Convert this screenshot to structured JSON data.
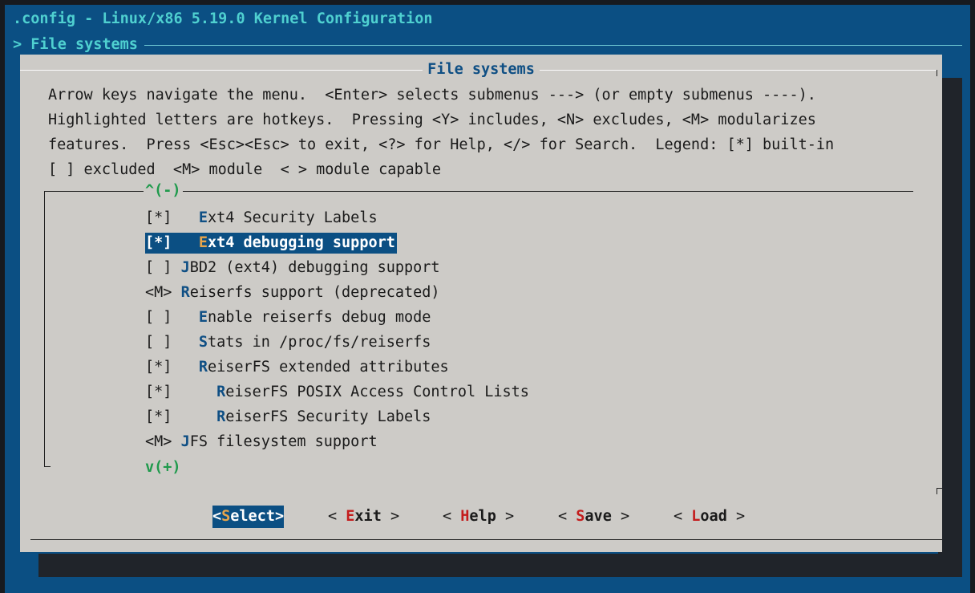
{
  "window": {
    "title": ".config - Linux/x86 5.19.0 Kernel Configuration",
    "breadcrumb": "> File systems"
  },
  "dialog": {
    "title": "File systems",
    "help_lines": [
      "Arrow keys navigate the menu.  <Enter> selects submenus ---> (or empty submenus ----).",
      "Highlighted letters are hotkeys.  Pressing <Y> includes, <N> excludes, <M> modularizes",
      "features.  Press <Esc><Esc> to exit, <?> for Help, </> for Search.  Legend: [*] built-in",
      "[ ] excluded  <M> module  < > module capable"
    ],
    "scroll_up": "^(-)",
    "scroll_down": "v(+)"
  },
  "menu": {
    "items": [
      {
        "prefix": "[*]   ",
        "hotkey": "E",
        "rest": "xt4 Security Labels"
      },
      {
        "prefix": "[*]   ",
        "hotkey": "E",
        "rest": "xt4 debugging support"
      },
      {
        "prefix": "[ ] ",
        "hotkey": "J",
        "rest": "BD2 (ext4) debugging support"
      },
      {
        "prefix": "<M> ",
        "hotkey": "R",
        "rest": "eiserfs support (deprecated)"
      },
      {
        "prefix": "[ ]   ",
        "hotkey": "E",
        "rest": "nable reiserfs debug mode"
      },
      {
        "prefix": "[ ]   ",
        "hotkey": "S",
        "rest": "tats in /proc/fs/reiserfs"
      },
      {
        "prefix": "[*]   ",
        "hotkey": "R",
        "rest": "eiserFS extended attributes"
      },
      {
        "prefix": "[*]     ",
        "hotkey": "R",
        "rest": "eiserFS POSIX Access Control Lists"
      },
      {
        "prefix": "[*]     ",
        "hotkey": "R",
        "rest": "eiserFS Security Labels"
      },
      {
        "prefix": "<M> ",
        "hotkey": "J",
        "rest": "FS filesystem support"
      }
    ],
    "selected_index": 1
  },
  "buttons": [
    {
      "open": "<",
      "hotkey": "S",
      "rest": "elect",
      "close": ">"
    },
    {
      "open": "< ",
      "hotkey": "E",
      "rest": "xit",
      "close": " >"
    },
    {
      "open": "< ",
      "hotkey": "H",
      "rest": "elp",
      "close": " >"
    },
    {
      "open": "< ",
      "hotkey": "S",
      "rest": "ave",
      "close": " >"
    },
    {
      "open": "< ",
      "hotkey": "L",
      "rest": "oad",
      "close": " >"
    }
  ],
  "colors": {
    "terminal_bg": "#0b4f83",
    "dialog_bg": "#cdcbc7",
    "title_fg": "#4fd0d0",
    "hotkey_menu": "#0f4f84",
    "hotkey_button": "#c41c1c",
    "hotkey_selected": "#e8a54b",
    "scroll_indicator": "#1f9a4c"
  }
}
